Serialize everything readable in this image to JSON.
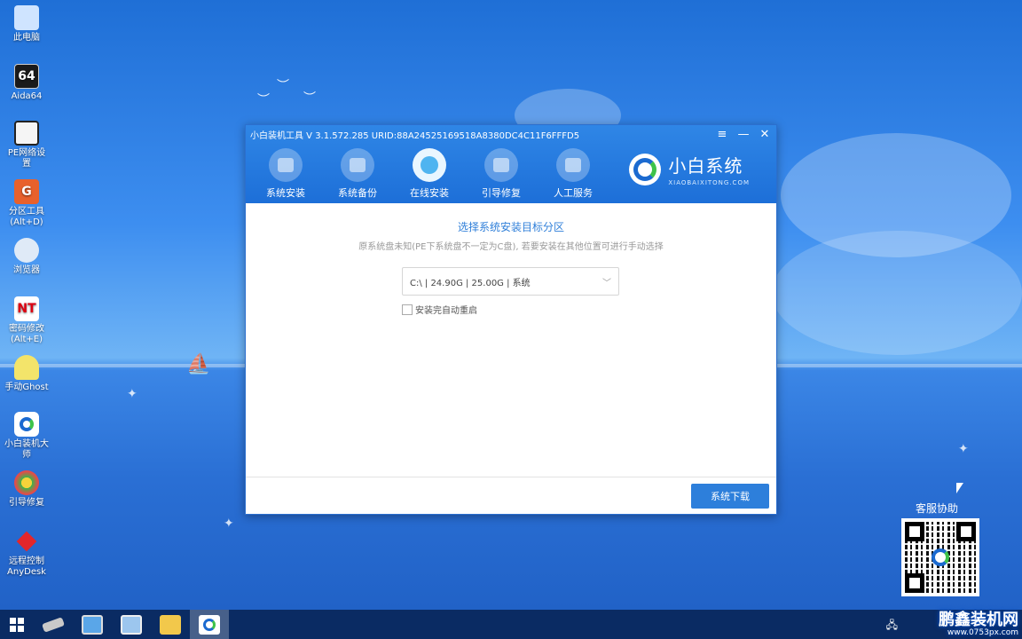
{
  "desktop": {
    "icons": [
      {
        "label": "此电脑",
        "icon": "computer-icon"
      },
      {
        "label": "Aida64",
        "icon": "aida64-icon",
        "glyph": "64"
      },
      {
        "label": "PE网络设置",
        "icon": "network-icon"
      },
      {
        "label": "分区工具\n(Alt+D)",
        "icon": "partition-tool-icon"
      },
      {
        "label": "浏览器",
        "icon": "browser-icon"
      },
      {
        "label": "密码修改\n(Alt+E)",
        "icon": "password-icon",
        "glyph": "NT"
      },
      {
        "label": "手动Ghost",
        "icon": "ghost-icon"
      },
      {
        "label": "小白装机大\n师",
        "icon": "xiaobai-icon"
      },
      {
        "label": "引导修复",
        "icon": "boot-repair-icon"
      },
      {
        "label": "远程控制\nAnyDesk",
        "icon": "anydesk-icon"
      }
    ]
  },
  "window": {
    "title": "小白装机工具 V 3.1.572.285 URID:88A24525169518A8380DC4C11F6FFFD5",
    "controls": {
      "menu": "≡",
      "minimize": "—",
      "close": "✕"
    },
    "nav": [
      {
        "label": "系统安装",
        "icon": "system-install-icon",
        "active": false
      },
      {
        "label": "系统备份",
        "icon": "system-backup-icon",
        "active": false
      },
      {
        "label": "在线安装",
        "icon": "online-install-icon",
        "active": true
      },
      {
        "label": "引导修复",
        "icon": "boot-repair-icon",
        "active": false
      },
      {
        "label": "人工服务",
        "icon": "support-chat-icon",
        "active": false
      }
    ],
    "brand": {
      "name": "小白系统",
      "sub": "XIAOBAIXITONG.COM"
    }
  },
  "content": {
    "title": "选择系统安装目标分区",
    "subtitle": "原系统盘未知(PE下系统盘不一定为C盘), 若要安装在其他位置可进行手动选择",
    "partition_select": {
      "value": "C:\\ | 24.90G | 25.00G | 系统"
    },
    "auto_restart": {
      "label": "安装完自动重启",
      "checked": false
    }
  },
  "footer": {
    "download_button": "系统下载"
  },
  "service": {
    "label": "客服协助"
  },
  "watermark": {
    "title": "鹏鑫装机网",
    "url": "www.0753px.com"
  },
  "colors": {
    "accent": "#2d7fdb",
    "header": "#1d6fd8",
    "title_blue": "#2f7fd9"
  }
}
